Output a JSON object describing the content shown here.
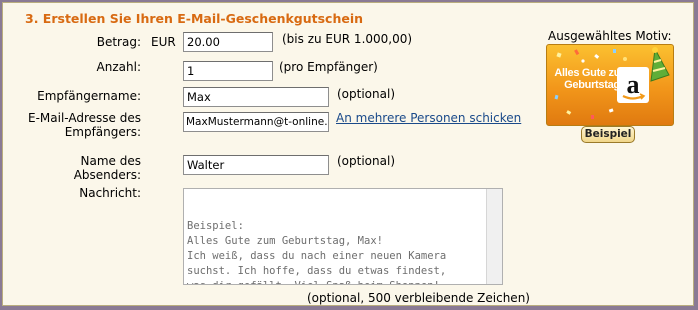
{
  "heading": "3. Erstellen Sie Ihren E-Mail-Geschenkgutschein",
  "betrag": {
    "label": "Betrag:",
    "currency": "EUR",
    "value": "20.00",
    "hint": "(bis zu EUR 1.000,00)"
  },
  "anzahl": {
    "label": "Anzahl:",
    "value": "1",
    "hint": "(pro Empfänger)"
  },
  "empfaengername": {
    "label": "Empfängername:",
    "value": "Max",
    "hint": "(optional)"
  },
  "email": {
    "label_line1": "E-Mail-Adresse des",
    "label_line2": "Empfängers:",
    "value": "MaxMustermann@t-online.de",
    "link": "An mehrere Personen schicken"
  },
  "absender": {
    "label_line1": "Name des",
    "label_line2": "Absenders:",
    "value": "Walter",
    "hint": "(optional)"
  },
  "nachricht": {
    "label": "Nachricht:",
    "text": "Beispiel:\nAlles Gute zum Geburtstag, Max!\nIch weiß, dass du nach einer neuen Kamera\nsuchst. Ich hoffe, dass du etwas findest,\nwas dir gefällt. Viel Spaß beim Shoppen!\n-- Walter",
    "counter": "(optional, 500 verbleibende Zeichen)"
  },
  "motif": {
    "title": "Ausgewähltes Motiv:",
    "card_text": "Alles Gute zum Geburtstag",
    "logo_letter": "a",
    "button": "Beispiel"
  },
  "colors": {
    "heading": "#d86a12",
    "link": "#1a4a8a",
    "card_orange": "#f2961a",
    "panel_bg": "#fbf7ea",
    "frame": "#8a7a94"
  }
}
